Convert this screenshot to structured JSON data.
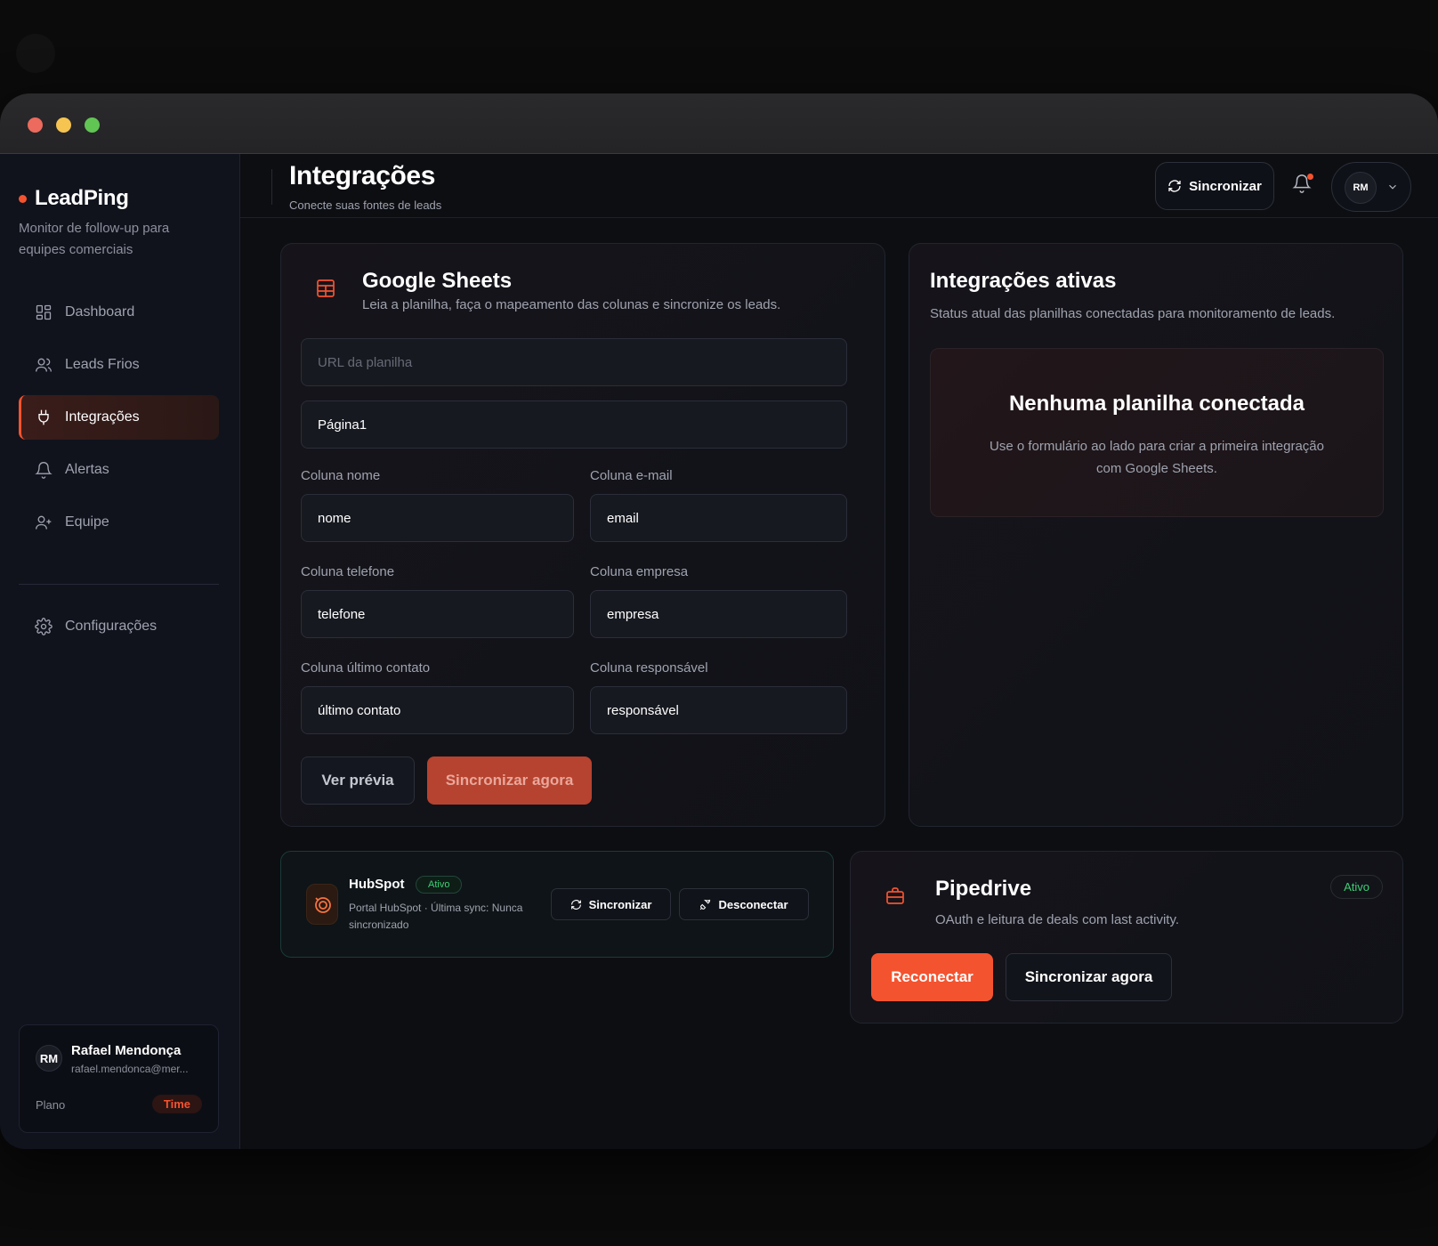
{
  "app": {
    "brand": "LeadPing",
    "tagline": "Monitor de follow-up para equipes comerciais"
  },
  "sidebar": {
    "items": [
      {
        "label": "Dashboard",
        "icon": "dashboard-icon"
      },
      {
        "label": "Leads Frios",
        "icon": "users-icon"
      },
      {
        "label": "Integrações",
        "icon": "plug-icon",
        "active": true
      },
      {
        "label": "Alertas",
        "icon": "bell-icon"
      },
      {
        "label": "Equipe",
        "icon": "user-plus-icon"
      }
    ],
    "settings": {
      "label": "Configurações",
      "icon": "gear-icon"
    },
    "user": {
      "initials": "RM",
      "name": "Rafael Mendonça",
      "email": "rafael.mendonca@mer...",
      "plan_label": "Plano",
      "plan": "Time"
    }
  },
  "header": {
    "title": "Integrações",
    "subtitle": "Conecte suas fontes de leads",
    "sync_label": "Sincronizar",
    "avatar_initials": "RM"
  },
  "google_sheets": {
    "title": "Google Sheets",
    "description": "Leia a planilha, faça o mapeamento das colunas e sincronize os leads.",
    "url_placeholder": "URL da planilha",
    "url_value": "",
    "sheet_value": "Página1",
    "fields": [
      {
        "label": "Coluna nome",
        "value": "nome"
      },
      {
        "label": "Coluna e-mail",
        "value": "email"
      },
      {
        "label": "Coluna telefone",
        "value": "telefone"
      },
      {
        "label": "Coluna empresa",
        "value": "empresa"
      },
      {
        "label": "Coluna último contato",
        "value": "último contato"
      },
      {
        "label": "Coluna responsável",
        "value": "responsável"
      }
    ],
    "preview_label": "Ver prévia",
    "sync_label": "Sincronizar agora"
  },
  "active_integrations": {
    "title": "Integrações ativas",
    "description": "Status atual das planilhas conectadas para monitoramento de leads.",
    "empty_title": "Nenhuma planilha conectada",
    "empty_text": "Use o formulário ao lado para criar a primeira integração com Google Sheets."
  },
  "hubspot": {
    "name": "HubSpot",
    "status": "Ativo",
    "meta": "Portal HubSpot · Última sync: Nunca sincronizado",
    "sync_label": "Sincronizar",
    "disconnect_label": "Desconectar"
  },
  "pipedrive": {
    "name": "Pipedrive",
    "description": "OAuth e leitura de deals com last activity.",
    "status": "Ativo",
    "reconnect_label": "Reconectar",
    "sync_label": "Sincronizar agora"
  },
  "colors": {
    "accent": "#f4532f",
    "success": "#3fcf74",
    "background": "#0d0e12"
  }
}
